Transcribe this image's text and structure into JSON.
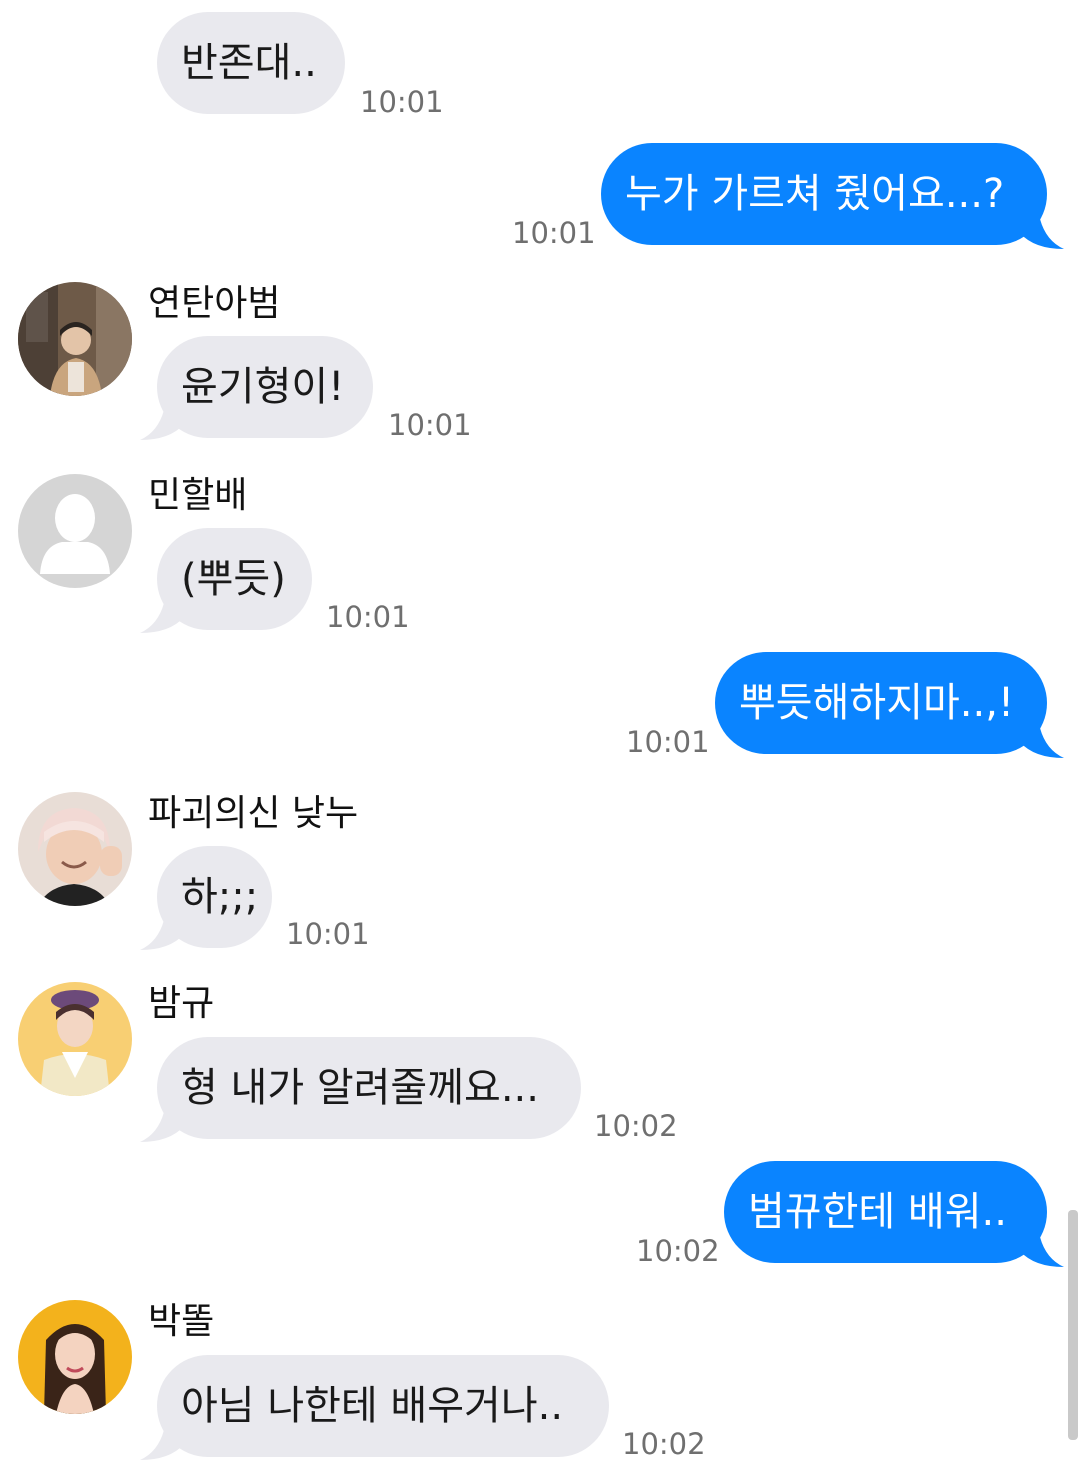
{
  "colors": {
    "incoming_bubble": "#e9e9ee",
    "outgoing_bubble": "#0a84ff",
    "timestamp": "#6f6f6f"
  },
  "messages": [
    {
      "direction": "incoming",
      "text": "반존대..",
      "time": "10:01"
    },
    {
      "direction": "outgoing",
      "text": "누가 가르쳐 줬어요...?",
      "time": "10:01"
    },
    {
      "direction": "incoming",
      "sender": "연탄아범",
      "avatar": "boy-photo-avatar",
      "text": "윤기형이!",
      "time": "10:01"
    },
    {
      "direction": "incoming",
      "sender": "민할배",
      "avatar": "default-user-avatar",
      "text": "(뿌듯)",
      "time": "10:01"
    },
    {
      "direction": "outgoing",
      "text": "뿌듯해하지마..,!",
      "time": "10:01"
    },
    {
      "direction": "incoming",
      "sender": "파괴의신 낮누",
      "avatar": "waving-boy-avatar",
      "text": "하;;;",
      "time": "10:01"
    },
    {
      "direction": "incoming",
      "sender": "밤규",
      "avatar": "boy-yellow-avatar",
      "text": "형 내가 알려줄께요...",
      "time": "10:02"
    },
    {
      "direction": "outgoing",
      "text": "범뀨한테 배워..",
      "time": "10:02"
    },
    {
      "direction": "incoming",
      "sender": "박똘",
      "avatar": "girl-yellow-avatar",
      "text": "아님 나한테 배우거나..",
      "time": "10:02"
    }
  ]
}
